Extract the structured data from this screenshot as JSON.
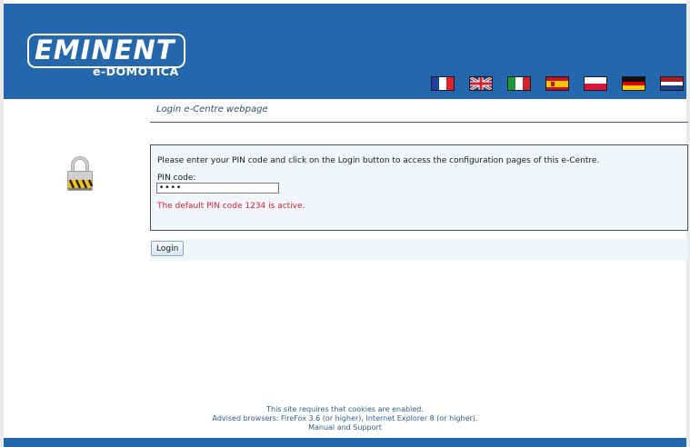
{
  "brand": {
    "logo_word": "EMINENT",
    "logo_sub": "e-DOMOTICA",
    "header_color": "#2467ad"
  },
  "languages": [
    {
      "code": "fr",
      "icon": "flag-france"
    },
    {
      "code": "en",
      "icon": "flag-uk"
    },
    {
      "code": "it",
      "icon": "flag-italy"
    },
    {
      "code": "es",
      "icon": "flag-spain"
    },
    {
      "code": "pl",
      "icon": "flag-poland"
    },
    {
      "code": "de",
      "icon": "flag-germany"
    },
    {
      "code": "nl",
      "icon": "flag-netherlands"
    }
  ],
  "page": {
    "title": "Login e-Centre webpage",
    "lock_icon": "padlock-icon"
  },
  "login": {
    "instruction": "Please enter your PIN code and click on the Login button to access the configuration pages of this e-Centre.",
    "pin_label": "PIN code:",
    "pin_value": "••••",
    "default_note": "The default PIN code 1234 is active.",
    "button_label": "Login",
    "note_color": "#e0202e"
  },
  "footer": {
    "line1": "This site requires that cookies are enabled.",
    "line2": "Advised browsers: FireFox 3.6 (or higher), Internet Explorer 8 (or higher).",
    "link": "Manual and Support"
  }
}
